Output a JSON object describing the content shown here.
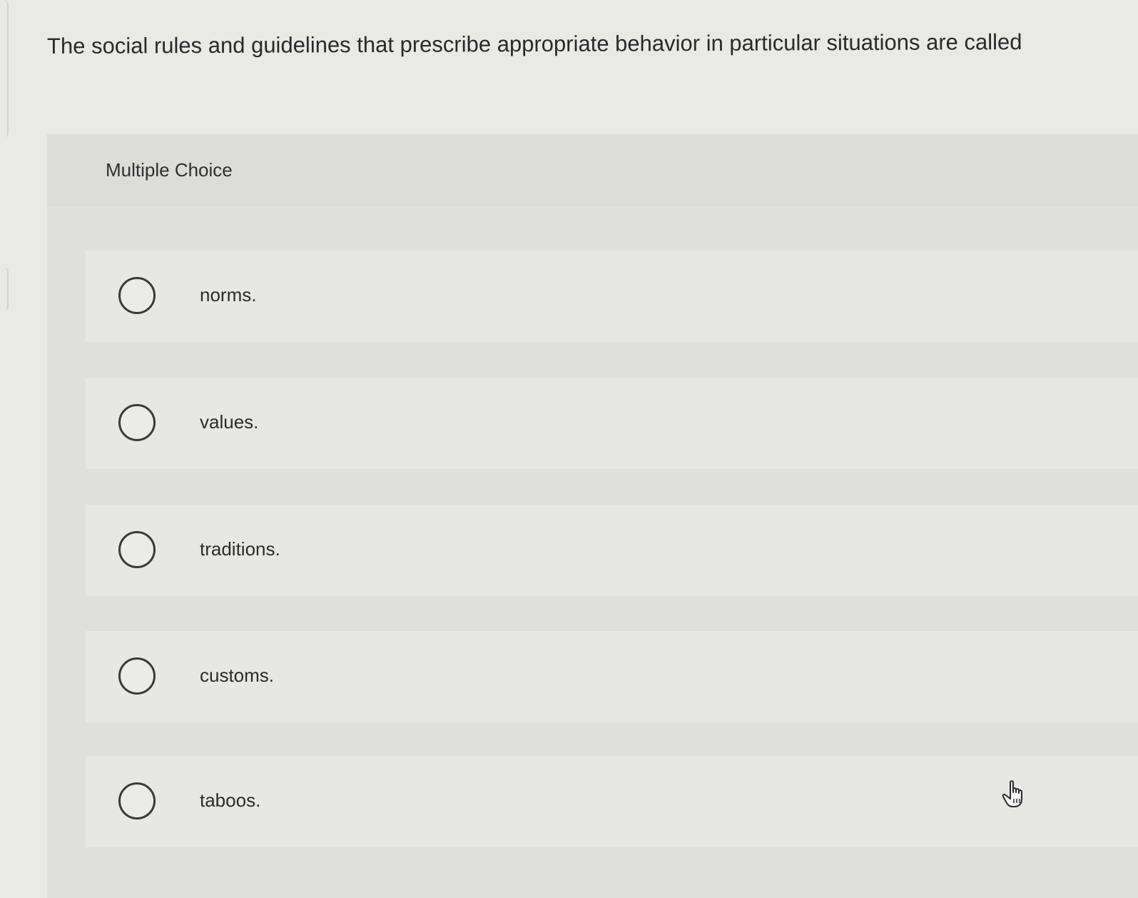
{
  "question": {
    "text": "The social rules and guidelines that prescribe appropriate behavior in particular situations are called"
  },
  "multiple_choice": {
    "label": "Multiple Choice",
    "options": [
      {
        "label": "norms."
      },
      {
        "label": "values."
      },
      {
        "label": "traditions."
      },
      {
        "label": "customs."
      },
      {
        "label": "taboos."
      }
    ]
  },
  "icons": {
    "radio": "radio-unselected-icon",
    "cursor": "hand-pointer-icon"
  },
  "colors": {
    "background": "#e9e9e8",
    "panel": "#dfdfde",
    "option_row": "#e7e7e6",
    "text": "#2b2b2b"
  }
}
